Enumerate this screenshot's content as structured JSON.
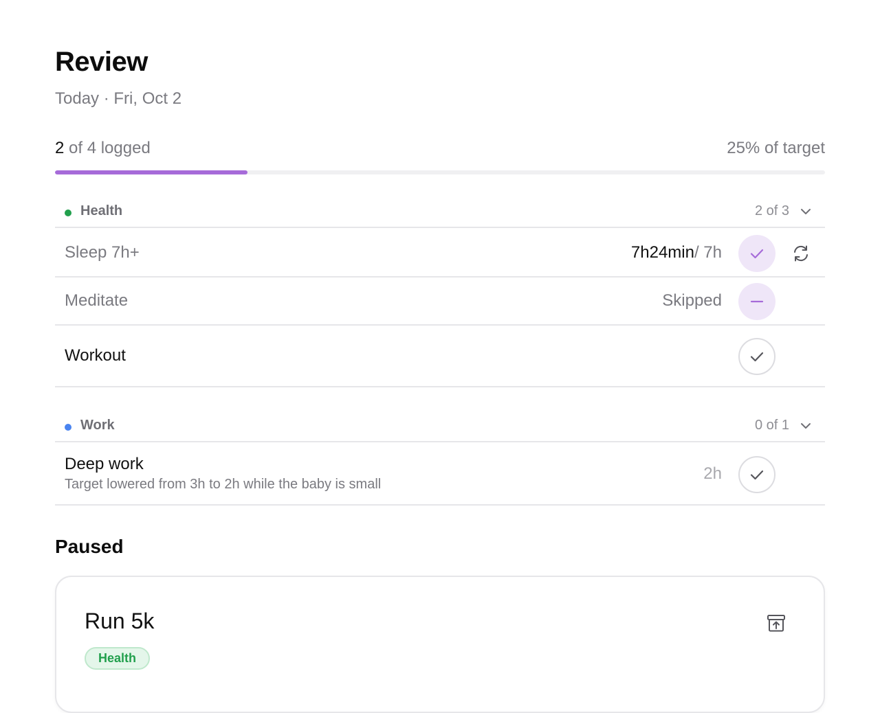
{
  "header": {
    "title": "Review",
    "subtitle": "Today · Fri, Oct 2"
  },
  "progress": {
    "logged_count": "2",
    "logged_rest": " of 4 logged",
    "target_text": "25% of target",
    "fraction": 0.25,
    "color": "#a66bd9"
  },
  "sections": [
    {
      "name": "Health",
      "count": "2 of 3",
      "dot_color": "#22a04d",
      "items": [
        {
          "label": "Sleep 7h+",
          "value_strong": "7h24min",
          "value_rest": "/ 7h",
          "state": "done"
        },
        {
          "label": "Meditate",
          "value": "Skipped",
          "state": "skipped"
        },
        {
          "label": "Workout",
          "state": "open"
        }
      ]
    },
    {
      "name": "Work",
      "count": "0 of 1",
      "dot_color": "#4a84f0",
      "items": [
        {
          "label": "Deep work",
          "description": "Target lowered from 3h to 2h while the baby is small",
          "value": "2h",
          "state": "open"
        }
      ]
    }
  ],
  "paused": {
    "title": "Paused",
    "cards": [
      {
        "title": "Run 5k",
        "tag": "Health"
      }
    ]
  },
  "icons": {
    "check": "check-icon",
    "minus": "minus-icon",
    "refresh": "refresh-icon",
    "chevron": "chevron-down-icon",
    "unarchive": "unarchive-icon"
  }
}
